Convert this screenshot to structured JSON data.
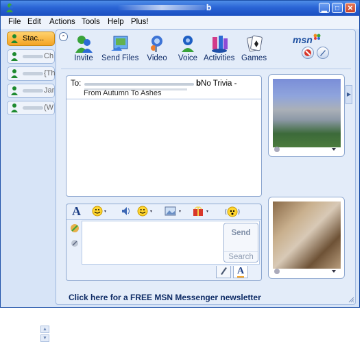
{
  "window": {
    "title": "b",
    "minimize_label": "▁",
    "maximize_label": "□",
    "close_label": "✕"
  },
  "menu": [
    "File",
    "Edit",
    "Actions",
    "Tools",
    "Help",
    "Plus!"
  ],
  "contacts": [
    {
      "name": "Stac...",
      "active": true
    },
    {
      "name": "Ch",
      "active": false
    },
    {
      "name": "{Th",
      "active": false
    },
    {
      "name": "Jar",
      "active": false
    },
    {
      "name": "(W",
      "active": false
    }
  ],
  "toolbar": {
    "collapse_label": "⌃",
    "buttons": [
      {
        "label": "Invite",
        "icon": "invite-icon"
      },
      {
        "label": "Send Files",
        "icon": "send-files-icon"
      },
      {
        "label": "Video",
        "icon": "video-icon"
      },
      {
        "label": "Voice",
        "icon": "voice-icon"
      },
      {
        "label": "Activities",
        "icon": "activities-icon"
      },
      {
        "label": "Games",
        "icon": "games-icon"
      }
    ],
    "brand": "msn"
  },
  "conversation": {
    "to_label": "To:",
    "to_name_partial": "b",
    "to_status": "No Trivia -",
    "to_line2": "From Autumn To Ashes"
  },
  "compose": {
    "send_label": "Send",
    "search_label": "Search"
  },
  "footer": {
    "newsletter": "Click here for a FREE MSN Messenger newsletter"
  },
  "colors": {
    "titlebar": "#2a64d5",
    "accent": "#1d4fa0",
    "active_contact": "#f4a324"
  }
}
